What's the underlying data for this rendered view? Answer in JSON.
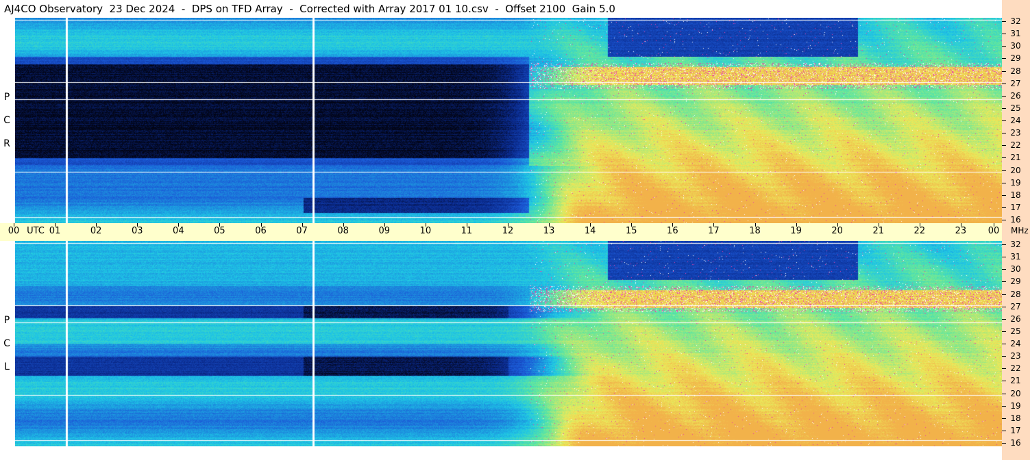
{
  "title": "AJ4CO Observatory  23 Dec 2024  -  DPS on TFD Array  -  Corrected with Array 2017 01 10.csv  -  Offset 2100  Gain 5.0",
  "chart_data": {
    "type": "heatmap",
    "title": "AJ4CO Observatory  23 Dec 2024  -  DPS on TFD Array  -  Corrected with Array 2017 01 10.csv  -  Offset 2100  Gain 5.0",
    "panels": [
      {
        "label_letters": [
          "R",
          "C",
          "P"
        ]
      },
      {
        "label_letters": [
          "L",
          "C",
          "P"
        ]
      }
    ],
    "x_axis": {
      "label": "UTC",
      "range_hours": [
        0,
        24
      ],
      "tick_labels": [
        "00",
        "UTC",
        "01",
        "02",
        "03",
        "04",
        "05",
        "06",
        "07",
        "08",
        "09",
        "10",
        "11",
        "12",
        "13",
        "14",
        "15",
        "16",
        "17",
        "18",
        "19",
        "20",
        "21",
        "22",
        "23",
        "00"
      ]
    },
    "y_axis": {
      "unit": "MHz",
      "range": [
        16,
        32
      ],
      "tick_labels": [
        "32",
        "31",
        "30",
        "29",
        "28",
        "27",
        "26",
        "25",
        "24",
        "23",
        "22",
        "21",
        "20",
        "19",
        "18",
        "17",
        "16"
      ]
    },
    "colors": {
      "dark": "#020414",
      "deep_blue": "#0a2a8c",
      "blue": "#1b58d6",
      "cyan": "#1ec6e6",
      "green": "#5ee6a0",
      "yellow": "#ecea5a",
      "orange": "#f2b24a",
      "magenta": "#ea3ca8",
      "white": "#ffffff"
    }
  }
}
